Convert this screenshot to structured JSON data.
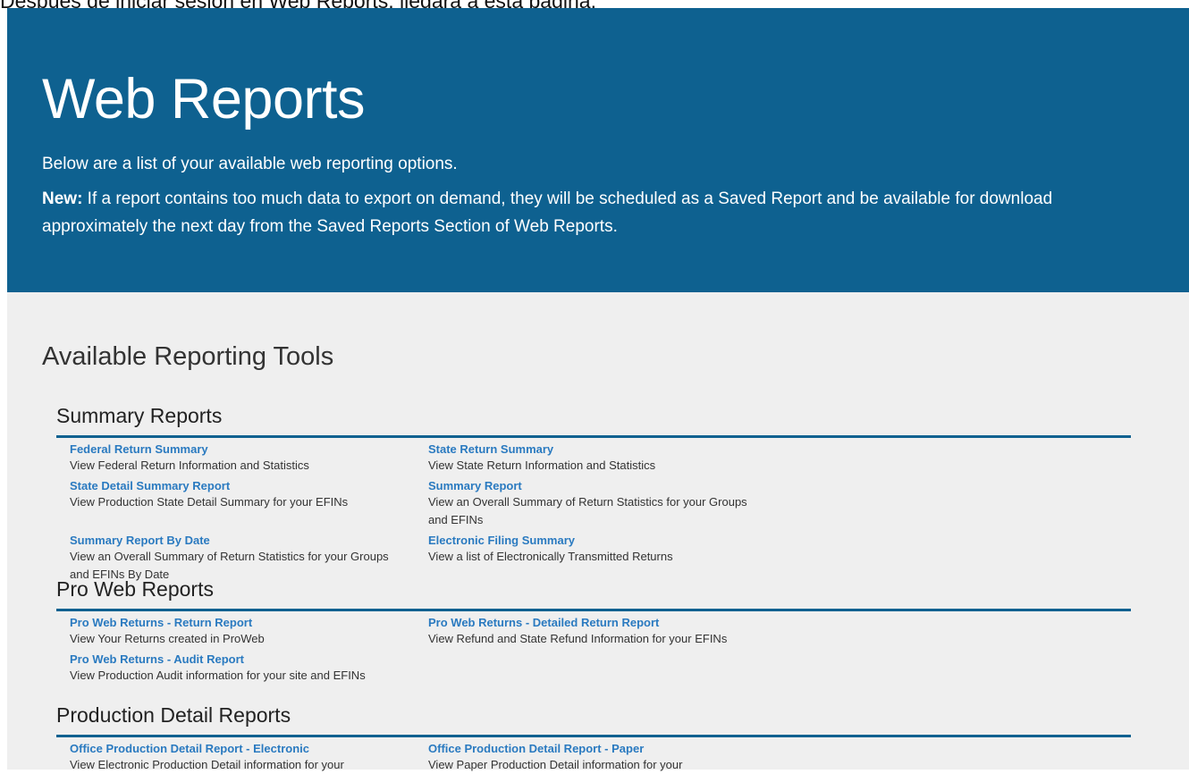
{
  "caption": "Después de iniciar sesión en Web Reports, llegará a esta página.",
  "header": {
    "title": "Web Reports",
    "intro": "Below are a list of your available web reporting options.",
    "notice_label": "New:",
    "notice_text": " If a report contains too much data to export on demand, they will be scheduled as a Saved Report and be available for download approximately the next day from the Saved Reports Section of Web Reports."
  },
  "main": {
    "heading": "Available Reporting Tools",
    "sections": [
      {
        "title": "Summary Reports",
        "items": [
          {
            "link": "Federal Return Summary",
            "desc": "View Federal Return Information and Statistics"
          },
          {
            "link": "State Return Summary",
            "desc": "View State Return Information and Statistics"
          },
          {
            "link": "State Detail Summary Report",
            "desc": "View Production State Detail Summary for your EFINs"
          },
          {
            "link": "Summary Report",
            "desc": "View an Overall Summary of Return Statistics for your Groups and EFINs"
          },
          {
            "link": "Summary Report By Date",
            "desc": "View an Overall Summary of Return Statistics for your Groups and EFINs By Date"
          },
          {
            "link": "Electronic Filing Summary",
            "desc": "View a list of Electronically Transmitted Returns"
          }
        ]
      },
      {
        "title": "Pro Web Reports",
        "items": [
          {
            "link": "Pro Web Returns - Return Report",
            "desc": "View Your Returns created in ProWeb"
          },
          {
            "link": "Pro Web Returns - Detailed Return Report",
            "desc": "View Refund and State Refund Information for your EFINs"
          },
          {
            "link": "Pro Web Returns - Audit Report",
            "desc": "View Production Audit information for your site and EFINs"
          }
        ]
      },
      {
        "title": "Production Detail Reports",
        "items": [
          {
            "link": "Office Production Detail Report - Electronic",
            "desc": "View Electronic Production Detail information for your"
          },
          {
            "link": "Office Production Detail Report - Paper",
            "desc": "View Paper Production Detail information for your"
          }
        ]
      }
    ]
  }
}
